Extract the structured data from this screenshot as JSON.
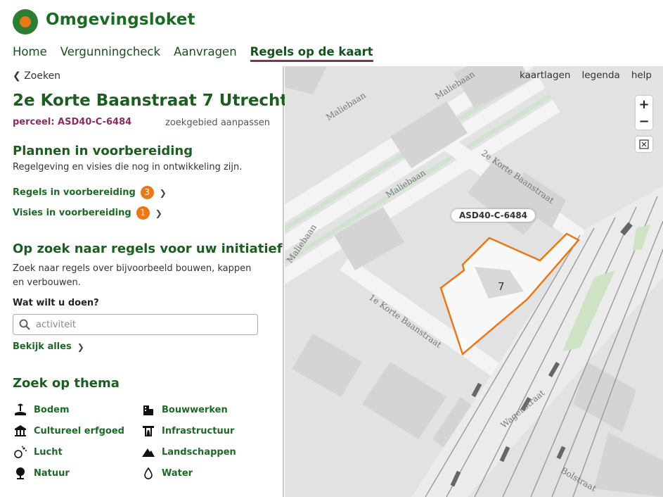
{
  "header": {
    "brand": "Omgevingsloket",
    "nav": [
      "Home",
      "Vergunningcheck",
      "Aanvragen",
      "Regels op de kaart"
    ]
  },
  "sidebar": {
    "back_label": "Zoeken",
    "address": "2e Korte Baanstraat 7 Utrecht",
    "perceel": "perceel: ASD40-C-6484",
    "zoek_aanpassen": "zoekgebied aanpassen",
    "plannen_title": "Plannen in voorbereiding",
    "plannen_desc": "Regelgeving en visies die nog in ontwikkeling zijn.",
    "regels_link": "Regels in voorbereiding",
    "regels_count": "3",
    "visies_link": "Visies in voorbereiding",
    "visies_count": "1",
    "zoek_title": "Op zoek naar regels voor uw initiatief",
    "zoek_desc": "Zoek naar regels over bijvoorbeeld bouwen, kappen en verbouwen.",
    "wat_label": "Wat wilt u doen?",
    "search_placeholder": "activiteit",
    "bekijk_alles": "Bekijk alles",
    "thema_title": "Zoek op thema",
    "themes": [
      "Bodem",
      "Bouwwerken",
      "Cultureel erfgoed",
      "Infrastructuur",
      "Lucht",
      "Landschappen",
      "Natuur",
      "Water"
    ]
  },
  "map": {
    "tools": [
      "kaartlagen",
      "legenda",
      "help"
    ],
    "parcel_label": "ASD40-C-6484",
    "house_number": "7",
    "streets": [
      "Maliebaan",
      "Maliebaan",
      "Maliebaan",
      "Maliebaan",
      "2e Korte Baanstraat",
      "1e Korte Baanstraat",
      "Wagenstraat",
      "Bolstraat"
    ],
    "accent": "#e87818"
  }
}
